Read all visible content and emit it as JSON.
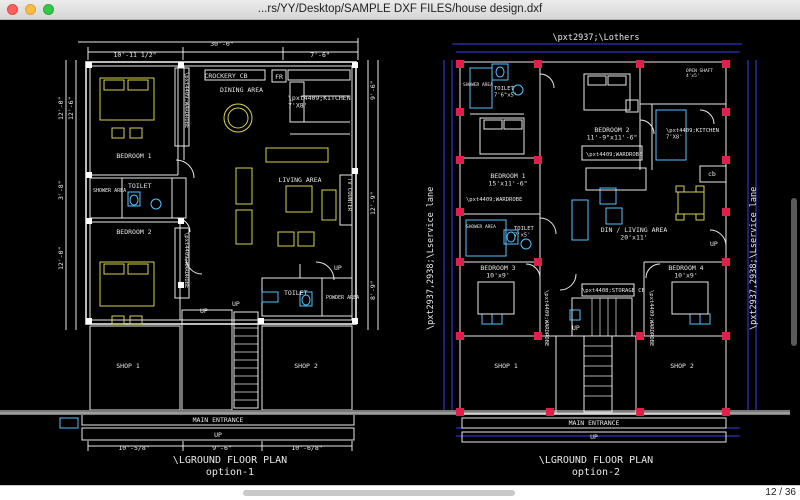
{
  "window": {
    "title": "...rs/YY/Desktop/SAMPLE DXF FILES/house design.dxf"
  },
  "plan1": {
    "title": "\\LGROUND FLOOR PLAN",
    "subtitle": "option-1",
    "dims_top": [
      "30'-0\"",
      "10'-11 1/2\"",
      "7'-6\""
    ],
    "dims_bottom": [
      "10'-5/8\"",
      "9'-6\"",
      "10'-6/8\""
    ],
    "dims_right": [
      "9'-6\"",
      "12'-9\"",
      "8'-9\""
    ],
    "dims_left": [
      "12'-0\"",
      "3'-8\"",
      "12'-0\"",
      "12'-6\""
    ],
    "rooms": {
      "crockery": "CROCKERY CB",
      "fr": "FR",
      "dining": "DINING AREA",
      "kitchen": "\\pxt4409;KITCHEN\n7'X8'",
      "bedroom1": "BEDROOM 1",
      "wardrobe1": "\\pxt4409;WARDROBE",
      "living": "LIVING AREA",
      "tvcounter": "TV COUNTER",
      "shower": "SHOWER AREA",
      "toilet1": "TOILET",
      "bedroom2": "BEDROOM 2",
      "wardrobe2": "\\pxt4409;WARDROBE",
      "toilet2": "TOILET",
      "powder": "POWDER AREA",
      "up1": "UP",
      "up2": "UP",
      "up3": "UP",
      "shop1": "SHOP 1",
      "shop2": "SHOP 2",
      "entrance": "MAIN ENTRANCE",
      "up_road": "UP"
    }
  },
  "plan2": {
    "title": "\\LGROUND FLOOR PLAN",
    "subtitle": "option-2",
    "top_note": "\\pxt2937;\\Lothers",
    "left_side": "\\pxt2937,2938;\\Lservice lane",
    "right_side": "\\pxt2937,2938;\\Lservice lane",
    "rooms": {
      "shower": "SHOWER AREA",
      "toilet_a": "TOILET\n7'6\"x5'",
      "bedroom1": "BEDROOM 1\n15'x11'-6\"",
      "wardrobe_a": "\\pxt4409;WARDROBE",
      "open_shaft": "OPEN SHAFT\n4'x5'",
      "bedroom2": "BEDROOM 2\n11'-9\"x11'-6\"",
      "wardrobe_b": "\\pxt4409;WARDROBE",
      "kitchen": "\\pxt4409;KITCHEN\n7'X8'",
      "cb": "cb",
      "shower2": "SHOWER AREA",
      "toilet_b": "TOILET\n7'x5'",
      "din_living": "DIN / LIVING AREA\n20'x11'",
      "up_mid": "UP",
      "bedroom3": "BEDROOM 3\n10'x9'",
      "storage": "\\pxt4408;STORAGE CB",
      "bedroom4": "BEDROOM 4\n10'x9'",
      "wardrobe_c": "\\pxt4409;WARDROBE",
      "wardrobe_d": "\\pxt4409;WARDROBE",
      "up_stair": "UP",
      "shop1": "SHOP 1",
      "shop2": "SHOP 2",
      "entrance": "MAIN ENTRANCE",
      "up_road": "UP"
    }
  },
  "status": {
    "page": "12 / 36"
  }
}
